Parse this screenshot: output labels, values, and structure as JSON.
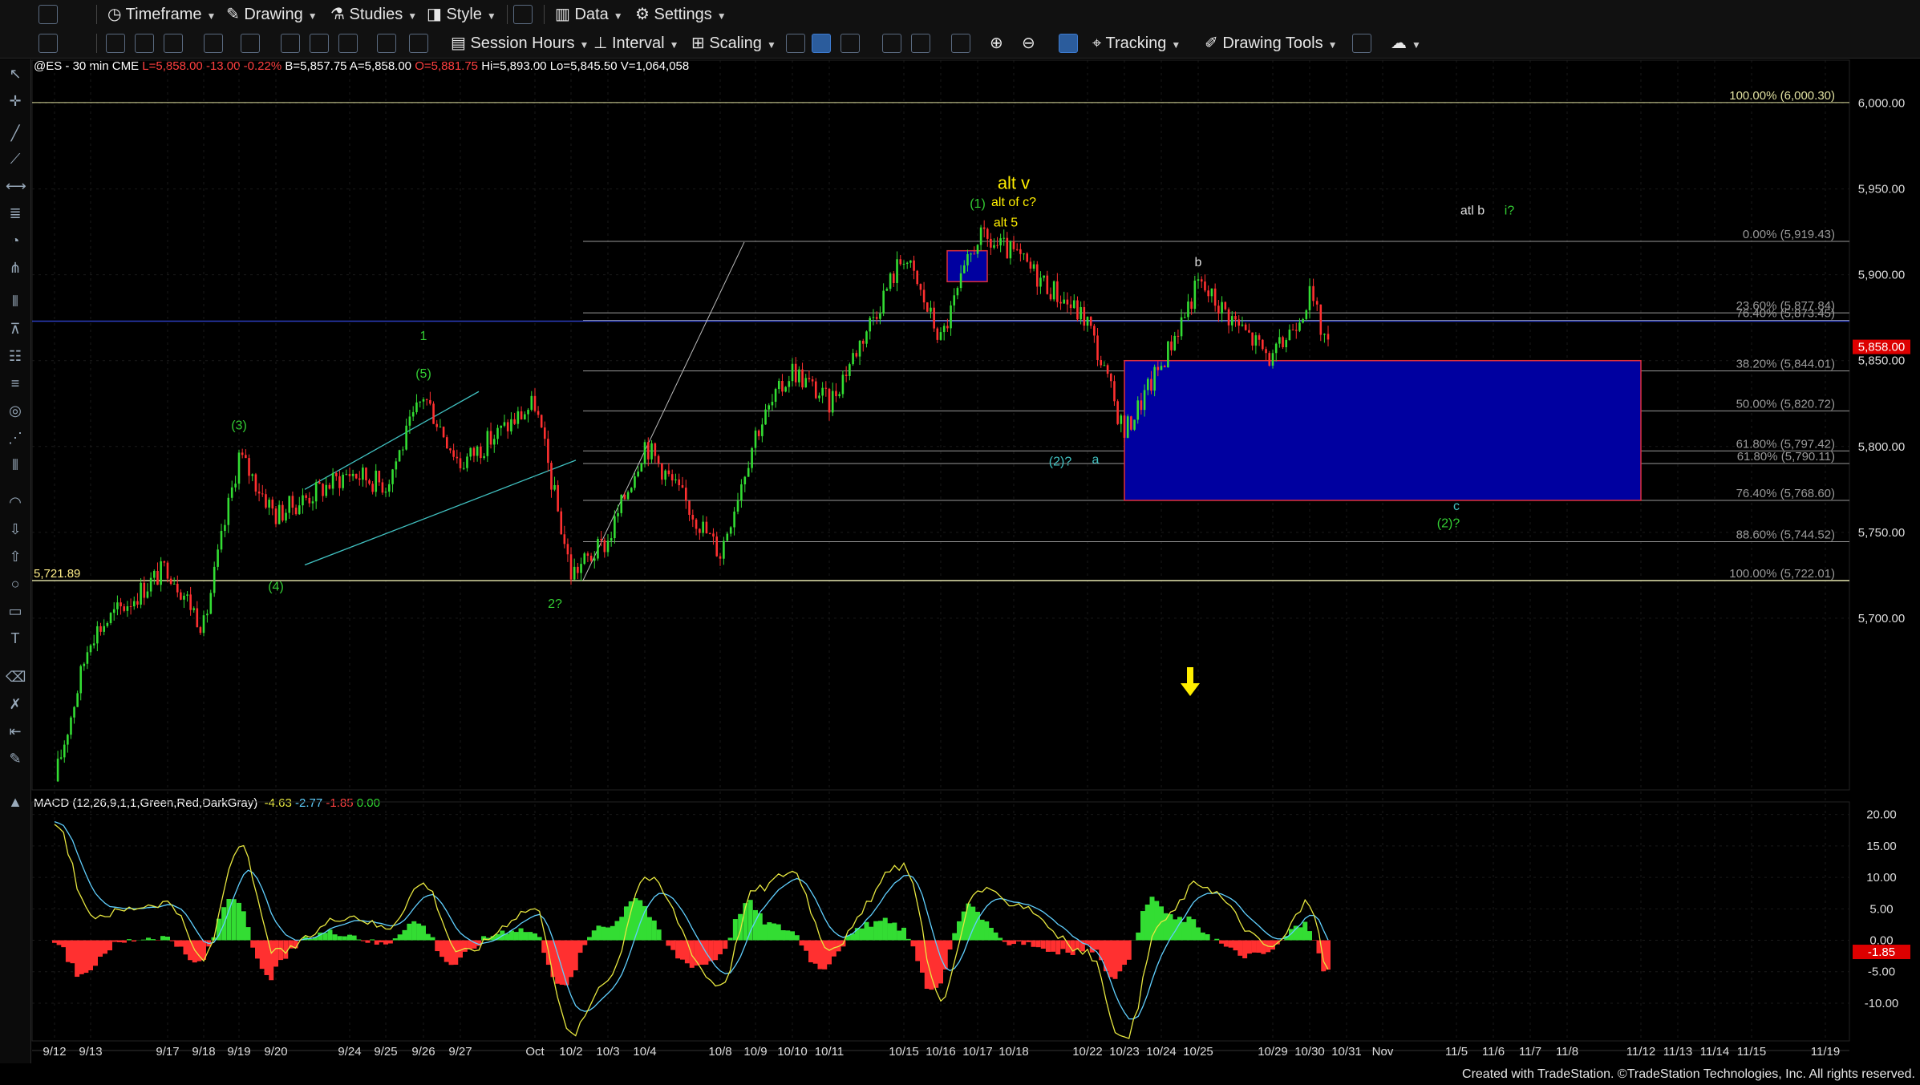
{
  "toolbar1": {
    "timeframe": "Timeframe",
    "drawing": "Drawing",
    "studies": "Studies",
    "style": "Style",
    "data": "Data",
    "settings": "Settings"
  },
  "toolbar2": {
    "session_hours": "Session Hours",
    "interval": "Interval",
    "scaling": "Scaling",
    "tracking": "Tracking",
    "drawing_tools": "Drawing Tools"
  },
  "status": {
    "symbol": "@ES - 30 min",
    "exchange": "CME",
    "last": "L=5,858.00",
    "change": "-13.00",
    "pct": "-0.22%",
    "bid": "B=5,857.75",
    "ask": "A=5,858.00",
    "open": "O=5,881.75",
    "hi": "Hi=5,893.00",
    "lo": "Lo=5,845.50",
    "vol": "V=1,064,058"
  },
  "macd_status": {
    "name": "MACD (12,26,9,1,1,Green,Red,DarkGray)",
    "macd": "-4.63",
    "avg": "-2.77",
    "diff": "-1.85",
    "zero": "0.00"
  },
  "credit": "Created with TradeStation. ©TradeStation Technologies, Inc. All rights reserved.",
  "colors": {
    "up": "#33dd33",
    "down": "#ff3030",
    "label_green": "#33cc33",
    "label_yellow": "#ffee00",
    "fib": "#999999",
    "box": "#0000a0",
    "box_border": "#e0303a",
    "hline": "#d8d8a0",
    "blue_hline": "#2c3dbd"
  },
  "chart_data": [
    {
      "type": "candlestick",
      "symbol": "@ES",
      "interval": "30 min",
      "x_labels": [
        "9/12",
        "9/13",
        "9/17",
        "9/18",
        "9/19",
        "9/20",
        "9/24",
        "9/25",
        "9/26",
        "9/27",
        "Oct",
        "10/2",
        "10/3",
        "10/4",
        "10/8",
        "10/9",
        "10/10",
        "10/11",
        "10/15",
        "10/16",
        "10/17",
        "10/18",
        "10/22",
        "10/23",
        "10/24",
        "10/25",
        "10/29",
        "10/30",
        "10/31",
        "Nov",
        "11/5",
        "11/6",
        "11/7",
        "11/8",
        "11/12",
        "11/13",
        "11/14",
        "11/15",
        "11/19"
      ],
      "ylim": [
        5600,
        6025
      ],
      "y_ticks": [
        "6,000.00",
        "5,950.00",
        "5,900.00",
        "5,850.00",
        "5,800.00",
        "5,750.00",
        "5,700.00"
      ],
      "anchor_path": [
        {
          "x": "9/12",
          "y": 5605
        },
        {
          "x": "9/13",
          "y": 5690
        },
        {
          "x": "9/17",
          "y": 5730
        },
        {
          "x": "9/18",
          "y": 5695
        },
        {
          "x": "9/19",
          "y": 5795
        },
        {
          "x": "9/20",
          "y": 5760
        },
        {
          "x": "9/24",
          "y": 5785
        },
        {
          "x": "9/25",
          "y": 5778
        },
        {
          "x": "9/26",
          "y": 5830
        },
        {
          "x": "9/27",
          "y": 5790
        },
        {
          "x": "Oct",
          "y": 5825
        },
        {
          "x": "10/2",
          "y": 5726
        },
        {
          "x": "10/3",
          "y": 5745
        },
        {
          "x": "10/4",
          "y": 5802
        },
        {
          "x": "10/8",
          "y": 5738
        },
        {
          "x": "10/9",
          "y": 5808
        },
        {
          "x": "10/10",
          "y": 5845
        },
        {
          "x": "10/11",
          "y": 5825
        },
        {
          "x": "10/15",
          "y": 5912
        },
        {
          "x": "10/16",
          "y": 5862
        },
        {
          "x": "10/17",
          "y": 5922
        },
        {
          "x": "10/18",
          "y": 5912
        },
        {
          "x": "10/22",
          "y": 5873
        },
        {
          "x": "10/23",
          "y": 5808
        },
        {
          "x": "10/24",
          "y": 5848
        },
        {
          "x": "10/25",
          "y": 5895
        },
        {
          "x": "10/29",
          "y": 5850
        },
        {
          "x": "10/30",
          "y": 5888
        },
        {
          "x": "10/30 close",
          "y": 5858
        }
      ],
      "last_price_label": "5,858.00",
      "left_price_label": "5,721.89",
      "fib_levels": [
        {
          "label": "100.00% (6,000.30)",
          "value": 6000.3,
          "color": "#e0e0a0"
        },
        {
          "label": "0.00% (5,919.43)",
          "value": 5919.43
        },
        {
          "label": "23.60% (5,877.84)",
          "value": 5877.84
        },
        {
          "label": "76.40% (5,873.45)",
          "value": 5873.45
        },
        {
          "label": "38.20% (5,844.01)",
          "value": 5844.01
        },
        {
          "label": "50.00% (5,820.72)",
          "value": 5820.72
        },
        {
          "label": "61.80% (5,797.42)",
          "value": 5797.42
        },
        {
          "label": "61.80% (5,790.11)",
          "value": 5790.11
        },
        {
          "label": "76.40% (5,768.60)",
          "value": 5768.6
        },
        {
          "label": "88.60% (5,744.52)",
          "value": 5744.52
        },
        {
          "label": "100.00% (5,722.01)",
          "value": 5722.01
        }
      ],
      "target_box": {
        "top": 5850,
        "bottom": 5768.6,
        "from": "10/23",
        "to": "11/12"
      },
      "small_box": {
        "top": 5914,
        "bottom": 5896,
        "from": "10/16",
        "to": "10/17"
      },
      "wave_labels": [
        {
          "text": "(3)",
          "x": "9/19",
          "y": 5810,
          "color": "green"
        },
        {
          "text": "(4)",
          "x": "9/20",
          "y": 5716,
          "color": "green"
        },
        {
          "text": "1",
          "x": "9/26",
          "y": 5862,
          "color": "green"
        },
        {
          "text": "(5)",
          "x": "9/26",
          "y": 5840,
          "color": "green"
        },
        {
          "text": "2?",
          "x": "10/2",
          "y": 5706,
          "color": "green"
        },
        {
          "text": "(1)",
          "x": "10/17",
          "y": 5939,
          "color": "green"
        },
        {
          "text": "alt v",
          "x": "10/18",
          "y": 5950,
          "color": "yellow"
        },
        {
          "text": "alt of c?",
          "x": "10/18",
          "y": 5940,
          "color": "yellow"
        },
        {
          "text": "alt 5",
          "x": "10/18",
          "y": 5928,
          "color": "yellow"
        },
        {
          "text": "(2)?",
          "x": "10/23",
          "y": 5789,
          "color": "teal"
        },
        {
          "text": "a",
          "x": "10/23",
          "y": 5790,
          "color": "teal"
        },
        {
          "text": "b",
          "x": "10/25",
          "y": 5905,
          "color": "white"
        },
        {
          "text": "atl b",
          "x": "11/5",
          "y": 5935,
          "color": "white"
        },
        {
          "text": "i?",
          "x": "11/6",
          "y": 5935,
          "color": "green"
        },
        {
          "text": "c",
          "x": "11/5",
          "y": 5763,
          "color": "teal"
        },
        {
          "text": "(2)?",
          "x": "11/5",
          "y": 5753,
          "color": "green"
        }
      ]
    },
    {
      "type": "macd",
      "name": "MACD (12,26,9,1,1,Green,Red,DarkGray)",
      "ylim": [
        -16,
        22
      ],
      "y_ticks": [
        "20.00",
        "15.00",
        "10.00",
        "5.00",
        "0.00",
        "-5.00",
        "-10.00"
      ],
      "last_value_label": "-1.85",
      "macd_path": [
        {
          "x": "9/12",
          "y": 19
        },
        {
          "x": "9/13",
          "y": 4
        },
        {
          "x": "9/17",
          "y": 6
        },
        {
          "x": "9/18",
          "y": -3
        },
        {
          "x": "9/19",
          "y": 15
        },
        {
          "x": "9/20",
          "y": -2
        },
        {
          "x": "9/24",
          "y": 4
        },
        {
          "x": "9/25",
          "y": 2
        },
        {
          "x": "9/26",
          "y": 9
        },
        {
          "x": "9/27",
          "y": -2
        },
        {
          "x": "Oct",
          "y": 5
        },
        {
          "x": "10/2",
          "y": -15
        },
        {
          "x": "10/3",
          "y": -6
        },
        {
          "x": "10/4",
          "y": 10
        },
        {
          "x": "10/8",
          "y": -7
        },
        {
          "x": "10/9",
          "y": 8
        },
        {
          "x": "10/10",
          "y": 11
        },
        {
          "x": "10/11",
          "y": -1
        },
        {
          "x": "10/15",
          "y": 12
        },
        {
          "x": "10/16",
          "y": -9
        },
        {
          "x": "10/17",
          "y": 8
        },
        {
          "x": "10/18",
          "y": 6
        },
        {
          "x": "10/22",
          "y": -2
        },
        {
          "x": "10/23",
          "y": -16
        },
        {
          "x": "10/24",
          "y": 3
        },
        {
          "x": "10/25",
          "y": 9
        },
        {
          "x": "10/29",
          "y": -1
        },
        {
          "x": "10/30",
          "y": 6
        },
        {
          "x": "10/30 close",
          "y": -4.63
        }
      ]
    }
  ]
}
